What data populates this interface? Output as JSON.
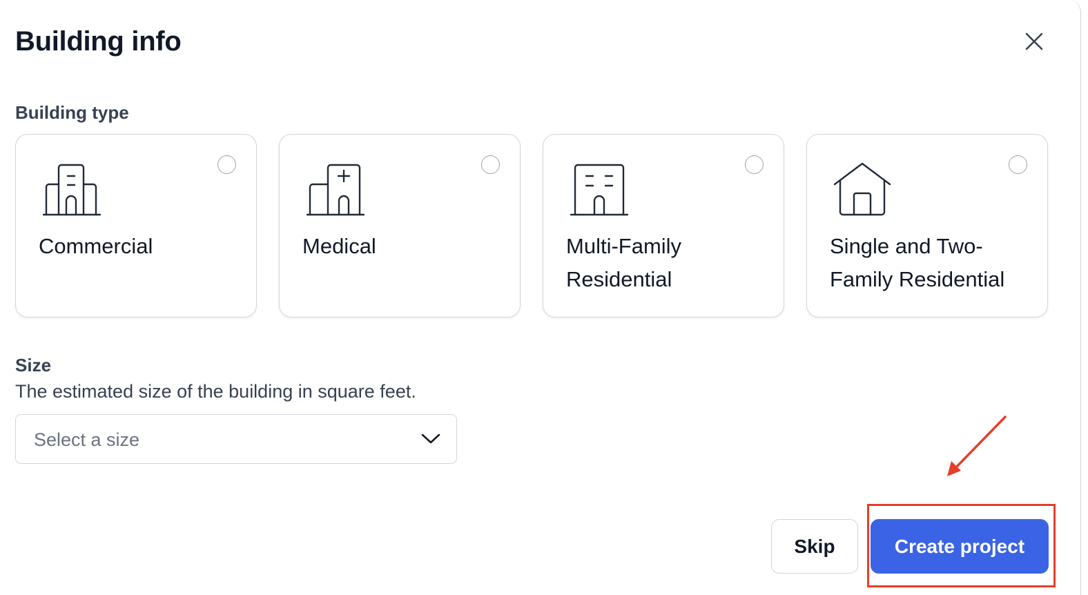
{
  "dialog": {
    "title": "Building info",
    "close_icon": "close-icon"
  },
  "building_type": {
    "label": "Building type",
    "options": [
      {
        "label": "Commercial",
        "icon": "commercial-building-icon",
        "selected": false
      },
      {
        "label": "Medical",
        "icon": "medical-building-icon",
        "selected": false
      },
      {
        "label": "Multi-Family Residential",
        "icon": "apartment-building-icon",
        "selected": false
      },
      {
        "label": "Single and Two-Family Residential",
        "icon": "house-icon",
        "selected": false
      }
    ]
  },
  "size": {
    "label": "Size",
    "description": "The estimated size of the building in square feet.",
    "placeholder": "Select a size",
    "chevron_icon": "chevron-down-icon"
  },
  "actions": {
    "skip_label": "Skip",
    "create_label": "Create project"
  },
  "colors": {
    "primary": "#3b63e6",
    "annotation": "#e53e2a"
  }
}
